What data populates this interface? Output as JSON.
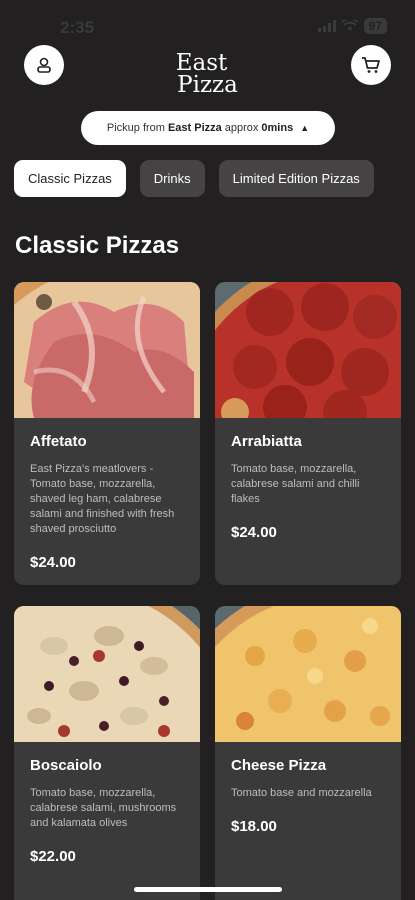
{
  "status": {
    "time": "2:35",
    "battery": "97"
  },
  "header": {
    "logo_line1": "East",
    "logo_line2": "Pizza"
  },
  "pickup": {
    "prefix": "Pickup from",
    "store": "East Pizza",
    "middle": "approx",
    "time": "0mins"
  },
  "tabs": [
    {
      "label": "Classic Pizzas",
      "active": true
    },
    {
      "label": "Drinks",
      "active": false
    },
    {
      "label": "Limited Edition Pizzas",
      "active": false
    }
  ],
  "section": {
    "title": "Classic Pizzas"
  },
  "products": [
    {
      "name": "Affetato",
      "desc": "East Pizza's meatlovers - Tomato base, mozzarella, shaved leg ham, calabrese salami and finished with fresh shaved prosciutto",
      "price": "$24.00"
    },
    {
      "name": "Arrabiatta",
      "desc": "Tomato base, mozzarella, calabrese salami and chilli flakes",
      "price": "$24.00"
    },
    {
      "name": "Boscaiolo",
      "desc": "Tomato base, mozzarella, calabrese salami, mushrooms and kalamata olives",
      "price": "$22.00"
    },
    {
      "name": "Cheese Pizza",
      "desc": "Tomato base and mozzarella",
      "price": "$18.00"
    }
  ]
}
